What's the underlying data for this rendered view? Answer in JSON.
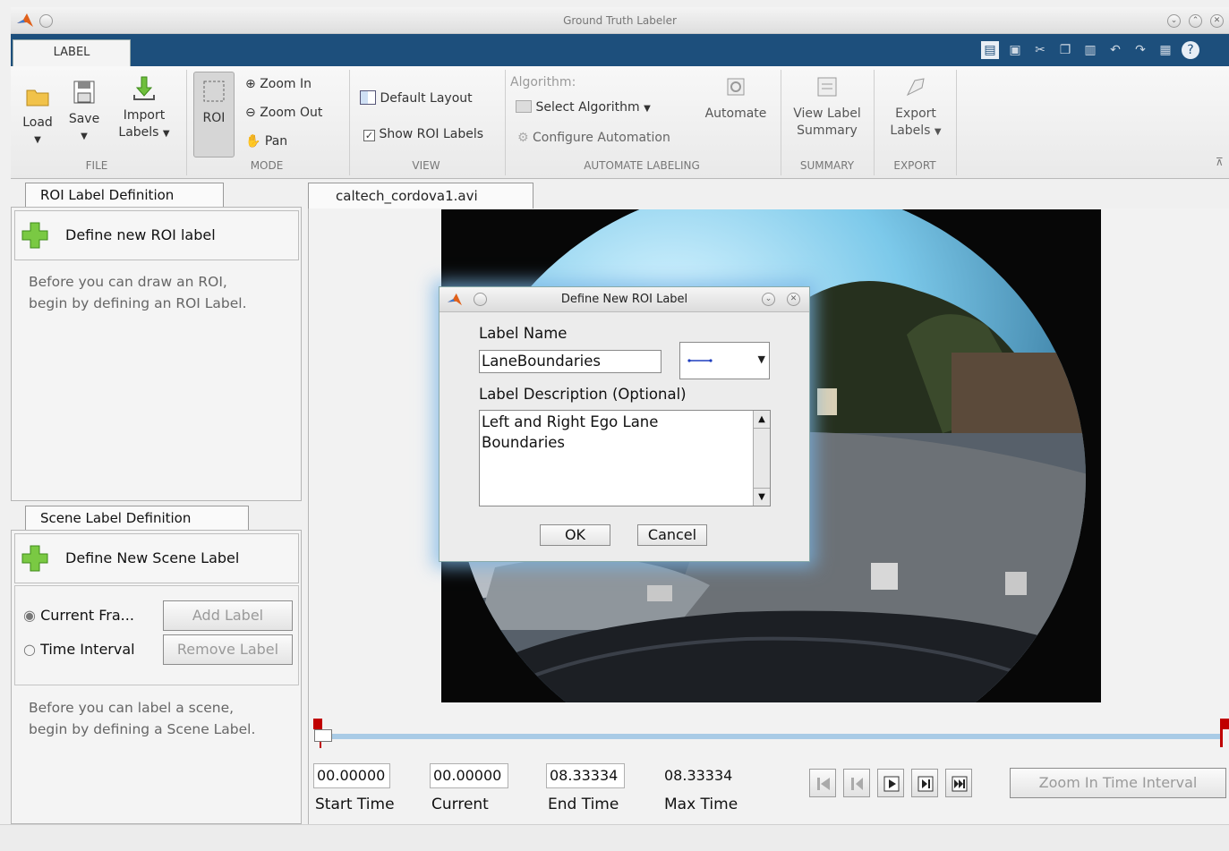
{
  "window": {
    "title": "Ground Truth Labeler"
  },
  "ribbon": {
    "tab": "LABEL",
    "file": {
      "load": "Load",
      "save": "Save",
      "import": "Import",
      "import2": "Labels",
      "group": "FILE"
    },
    "mode": {
      "roi": "ROI",
      "zoom_in": "Zoom In",
      "zoom_out": "Zoom Out",
      "pan": "Pan",
      "group": "MODE"
    },
    "view": {
      "default_layout": "Default Layout",
      "show_roi_labels": "Show ROI Labels",
      "show_roi_checked": true,
      "group": "VIEW"
    },
    "automate": {
      "algorithm": "Algorithm:",
      "select_algorithm": "Select Algorithm",
      "configure": "Configure Automation",
      "automate": "Automate",
      "group": "AUTOMATE LABELING"
    },
    "summary": {
      "view1": "View Label",
      "view2": "Summary",
      "group": "SUMMARY"
    },
    "export": {
      "export1": "Export",
      "export2": "Labels",
      "group": "EXPORT"
    }
  },
  "roi_panel": {
    "tab": "ROI Label Definition",
    "define_button": "Define new ROI label",
    "hint1": "Before you can draw an ROI,",
    "hint2": "begin by defining an ROI Label."
  },
  "scene_panel": {
    "tab": "Scene Label Definition",
    "define_button": "Define New Scene Label",
    "radio_current": "Current Fra...",
    "radio_interval": "Time Interval",
    "add_label": "Add Label",
    "remove_label": "Remove Label",
    "hint1": "Before you can label a scene,",
    "hint2": "begin by defining a Scene Label."
  },
  "video": {
    "tab": "caltech_cordova1.avi"
  },
  "dialog": {
    "title": "Define New ROI Label",
    "label_name_caption": "Label Name",
    "label_name_value": "LaneBoundaries",
    "description_caption": "Label Description (Optional)",
    "description_line1": "Left and Right Ego Lane",
    "description_line2": "Boundaries",
    "ok": "OK",
    "cancel": "Cancel"
  },
  "timeline": {
    "start_time": "00.00000",
    "start_label": "Start Time",
    "current_time": "00.00000",
    "current_label": "Current",
    "end_time": "08.33334",
    "end_label": "End Time",
    "max_time": "08.33334",
    "max_label": "Max Time",
    "zoom_interval": "Zoom In Time Interval"
  },
  "colors": {
    "ribbon_tab_strip": "#1d4f7c",
    "plus_green": "#7ac943",
    "line_blue": "#1f3fbf",
    "playhead_red": "#c00000"
  }
}
